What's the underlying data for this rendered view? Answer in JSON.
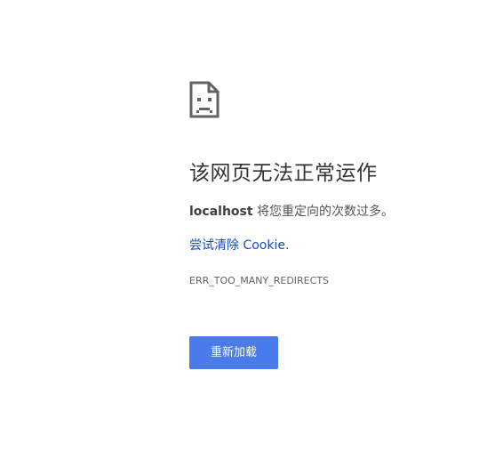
{
  "error_page": {
    "icon": "sad-page-icon",
    "title": "该网页无法正常运作",
    "message_host": "localhost",
    "message_text": " 将您重定向的次数过多。",
    "suggestion_link": "尝试清除 Cookie.",
    "error_code": "ERR_TOO_MANY_REDIRECTS",
    "reload_button": "重新加载"
  },
  "colors": {
    "background": "#ffffff",
    "title": "#333333",
    "link": "#1a4cb8",
    "button": "#4a7bea",
    "button_text": "#ffffff"
  }
}
